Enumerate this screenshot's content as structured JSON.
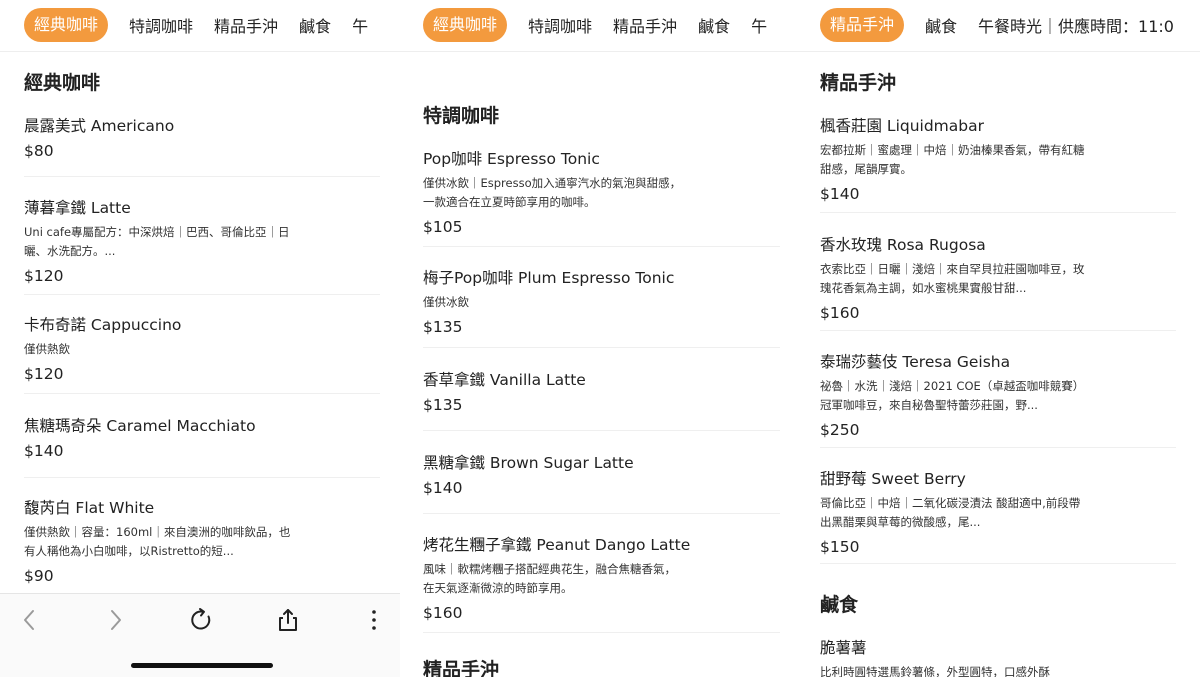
{
  "panels": [
    {
      "tabs": [
        "經典咖啡",
        "特調咖啡",
        "精品手沖",
        "鹹食",
        "午"
      ],
      "active": 0,
      "section": "經典咖啡",
      "items": [
        {
          "name": "晨露美式 Americano",
          "desc": "",
          "price": "$80"
        },
        {
          "name": "薄暮拿鐵 Latte",
          "desc": "Uni cafe專屬配方：中深烘焙｜巴西、哥倫比亞｜日曬、水洗配方。...",
          "price": "$120"
        },
        {
          "name": "卡布奇諾 Cappuccino",
          "desc": "僅供熱飲",
          "price": "$120"
        },
        {
          "name": "焦糖瑪奇朵 Caramel Macchiato",
          "desc": "",
          "price": "$140"
        },
        {
          "name": "馥芮白 Flat White",
          "desc": "僅供熱飲｜容量：160ml｜來自澳洲的咖啡飲品，也有人稱他為小白咖啡，以Ristretto的短...",
          "price": "$90"
        }
      ]
    },
    {
      "tabs": [
        "經典咖啡",
        "特調咖啡",
        "精品手沖",
        "鹹食",
        "午"
      ],
      "active": 0,
      "section": "特調咖啡",
      "next_section": "精品手沖",
      "items": [
        {
          "name": "Pop咖啡 Espresso Tonic",
          "desc": "僅供冰飲｜Espresso加入通寧汽水的氣泡與甜感，一款適合在立夏時節享用的咖啡。",
          "price": "$105"
        },
        {
          "name": "梅子Pop咖啡 Plum Espresso Tonic",
          "desc": "僅供冰飲",
          "price": "$135"
        },
        {
          "name": "香草拿鐵 Vanilla Latte",
          "desc": "",
          "price": "$135"
        },
        {
          "name": "黑糖拿鐵 Brown Sugar Latte",
          "desc": "",
          "price": "$140"
        },
        {
          "name": "烤花生糰子拿鐵 Peanut Dango Latte",
          "desc": "風味｜軟糯烤糰子搭配經典花生，融合焦糖香氣，在天氣逐漸微涼的時節享用。",
          "price": "$160"
        }
      ]
    },
    {
      "tabs": [
        "精品手沖",
        "鹹食",
        "午餐時光｜供應時間：11:0"
      ],
      "active": 0,
      "section": "精品手沖",
      "next_section": "鹹食",
      "items": [
        {
          "name": "楓香莊園 Liquidmabar",
          "desc": "宏都拉斯｜蜜處理｜中焙｜奶油榛果香氣，帶有紅糖甜感，尾韻厚實。",
          "price": "$140"
        },
        {
          "name": "香水玫瑰 Rosa Rugosa",
          "desc": "衣索比亞｜日曬｜淺焙｜來自罕貝拉莊園咖啡豆，玫瑰花香氣為主調，如水蜜桃果實般甘甜...",
          "price": "$160"
        },
        {
          "name": "泰瑞莎藝伎 Teresa Geisha",
          "desc": "祕魯｜水洗｜淺焙｜2021 COE（卓越盃咖啡競賽）冠軍咖啡豆，來自秘魯聖特蕾莎莊園，野...",
          "price": "$250"
        },
        {
          "name": "甜野莓 Sweet Berry",
          "desc": "哥倫比亞｜中焙｜二氧化碳浸漬法 酸甜適中,前段帶出黑醋栗與草莓的微酸感，尾...",
          "price": "$150"
        }
      ],
      "savory_first": {
        "name": "脆薯薯",
        "desc": "比利時圓特選馬鈴薯條，外型圓特，口感外酥"
      }
    }
  ],
  "icons": {
    "back": "chevron-left-icon",
    "forward": "chevron-right-icon",
    "reload": "reload-icon",
    "share": "share-icon",
    "more": "more-vertical-icon"
  },
  "colors": {
    "accent": "#f39a3e"
  }
}
